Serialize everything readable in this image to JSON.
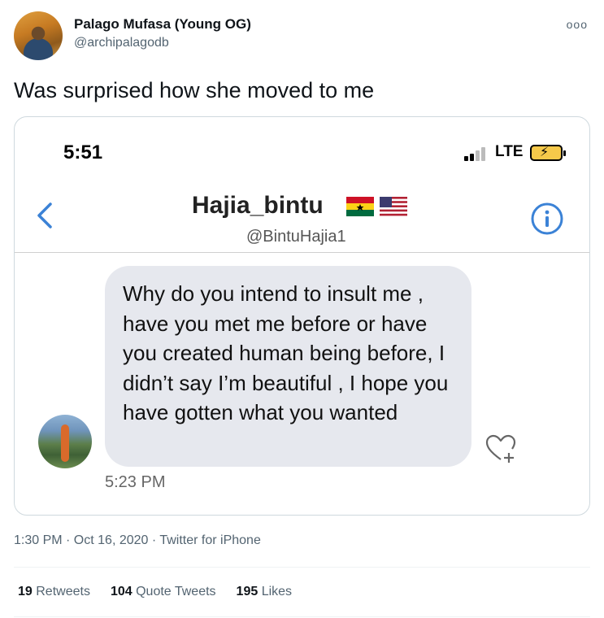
{
  "author": {
    "name": "Palago Mufasa (Young OG)",
    "handle": "@archipalagodb"
  },
  "more_menu": "ooo",
  "tweet": {
    "text": "Was surprised how she moved to me",
    "timestamp": "1:30 PM · Oct 16, 2020 · Twitter for iPhone"
  },
  "screenshot": {
    "status_time": "5:51",
    "network": "LTE",
    "dm_title": "Hajia_bintu",
    "dm_handle": "@BintuHajia1",
    "message": "Why do you intend to insult me , have you met me before or have you created human being before, I didn’t say I’m beautiful , I hope you have gotten what you wanted",
    "message_time": "5:23 PM",
    "colors": {
      "accent_blue": "#3b82d6",
      "bubble_bg": "#e6e8ee"
    }
  },
  "stats": {
    "retweets_count": "19",
    "retweets_label": "Retweets",
    "quotes_count": "104",
    "quotes_label": "Quote Tweets",
    "likes_count": "195",
    "likes_label": "Likes"
  }
}
